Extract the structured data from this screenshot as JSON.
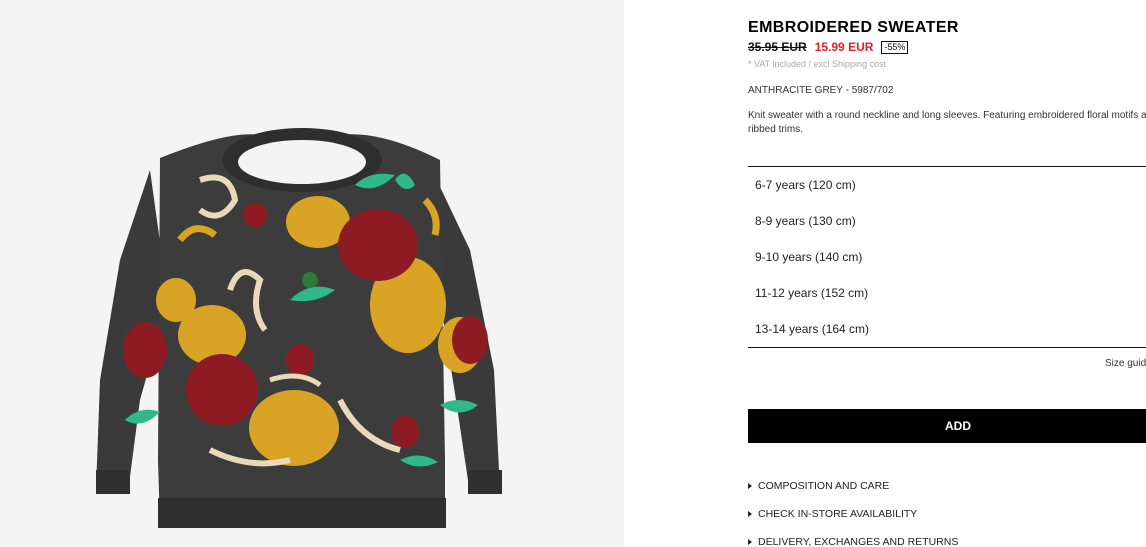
{
  "product": {
    "title": "EMBROIDERED SWEATER",
    "old_price": "35.95 EUR",
    "new_price": "15.99 EUR",
    "discount": "-55%",
    "vat_note": "* VAT included / excl Shipping cost",
    "color_ref": "ANTHRACITE GREY - 5987/702",
    "description": "Knit sweater with a round neckline and long sleeves. Featuring embroidered floral motifs and ribbed trims.",
    "image": "embroidered-sweater-photo"
  },
  "sizes": [
    {
      "label": "6-7 years (120 cm)"
    },
    {
      "label": "8-9 years (130 cm)"
    },
    {
      "label": "9-10 years (140 cm)"
    },
    {
      "label": "11-12 years (152 cm)"
    },
    {
      "label": "13-14 years (164 cm)"
    }
  ],
  "size_guide_label": "Size guide",
  "add_label": "ADD",
  "links": [
    {
      "label": "COMPOSITION AND CARE"
    },
    {
      "label": "CHECK IN-STORE AVAILABILITY"
    },
    {
      "label": "DELIVERY, EXCHANGES AND RETURNS"
    }
  ],
  "colors": {
    "sale_red": "#e2202b",
    "sweater_grey": "#3c3c3c",
    "button_black": "#000000"
  }
}
